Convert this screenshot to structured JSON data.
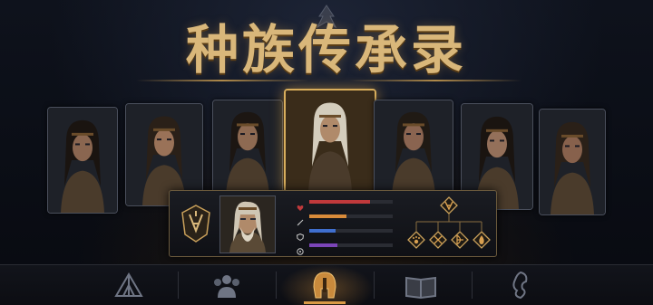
{
  "title": "种族传承录",
  "colors": {
    "gold": "#d9b77a",
    "accent": "#d99a45",
    "health": "#c0393b",
    "attack": "#d98b3a",
    "defense": "#3f6fcf",
    "magic": "#7b45b8"
  },
  "portraits": [
    {
      "name": "portrait-1",
      "selected": false
    },
    {
      "name": "portrait-2",
      "selected": false
    },
    {
      "name": "portrait-3",
      "selected": false
    },
    {
      "name": "portrait-4",
      "selected": true
    },
    {
      "name": "portrait-5",
      "selected": false
    },
    {
      "name": "portrait-6",
      "selected": false
    },
    {
      "name": "portrait-7",
      "selected": false
    }
  ],
  "stats": [
    {
      "icon": "heart-icon",
      "value": 0.73
    },
    {
      "icon": "sword-icon",
      "value": 0.45
    },
    {
      "icon": "shield-icon",
      "value": 0.32
    },
    {
      "icon": "magic-icon",
      "value": 0.34
    }
  ],
  "skill_tree": {
    "root_icon": "crest-icon",
    "children": [
      "paw-icon",
      "crossed-weapons-icon",
      "bow-icon",
      "flame-icon"
    ]
  },
  "nav": [
    {
      "icon": "tent-icon",
      "selected": false
    },
    {
      "icon": "group-icon",
      "selected": false
    },
    {
      "icon": "helmet-icon",
      "selected": true
    },
    {
      "icon": "book-icon",
      "selected": false
    },
    {
      "icon": "dragon-icon",
      "selected": false
    }
  ]
}
